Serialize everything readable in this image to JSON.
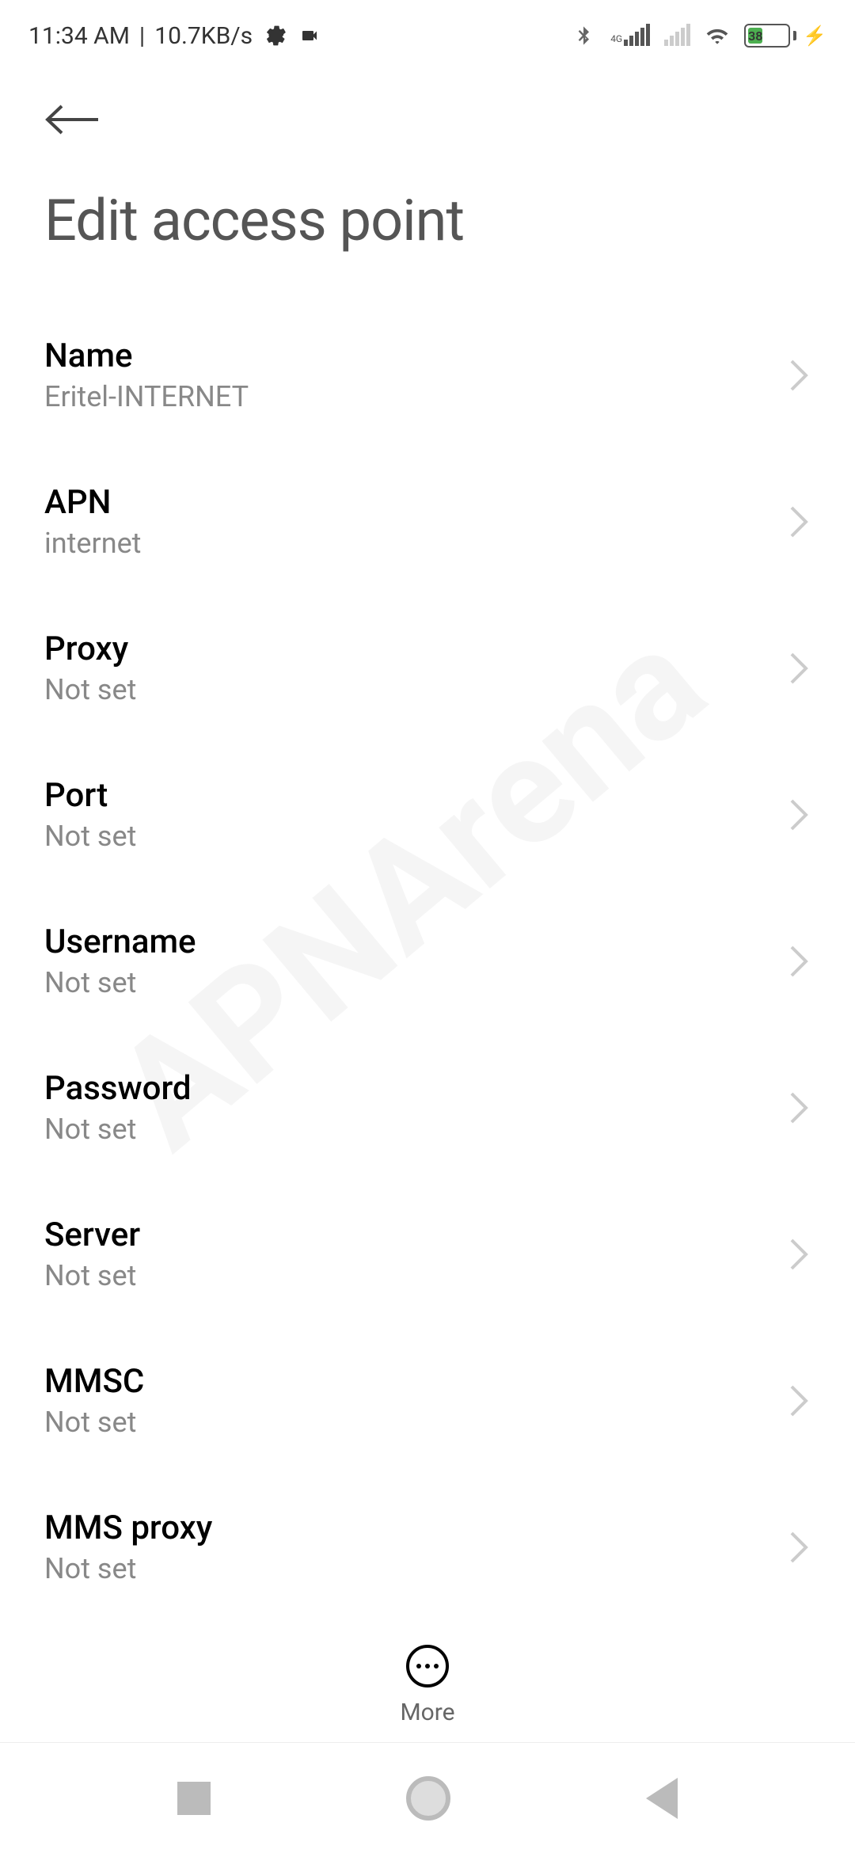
{
  "status_bar": {
    "time": "11:34 AM",
    "separator": " | ",
    "network_speed": "10.7KB/s",
    "battery_percent": "38",
    "network_type": "4G"
  },
  "page": {
    "title": "Edit access point"
  },
  "settings": [
    {
      "label": "Name",
      "value": "Eritel-INTERNET"
    },
    {
      "label": "APN",
      "value": "internet"
    },
    {
      "label": "Proxy",
      "value": "Not set"
    },
    {
      "label": "Port",
      "value": "Not set"
    },
    {
      "label": "Username",
      "value": "Not set"
    },
    {
      "label": "Password",
      "value": "Not set"
    },
    {
      "label": "Server",
      "value": "Not set"
    },
    {
      "label": "MMSC",
      "value": "Not set"
    },
    {
      "label": "MMS proxy",
      "value": "Not set"
    }
  ],
  "bottom": {
    "more_label": "More"
  },
  "watermark": "APNArena"
}
